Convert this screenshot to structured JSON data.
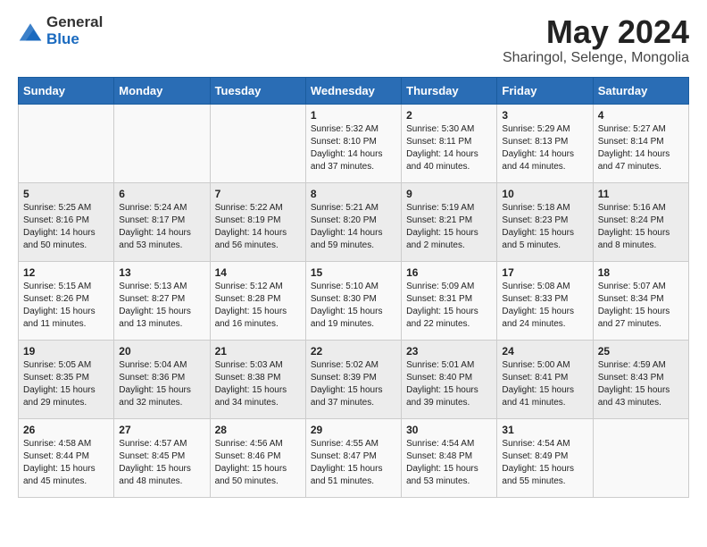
{
  "logo": {
    "general": "General",
    "blue": "Blue"
  },
  "title": "May 2024",
  "subtitle": "Sharingol, Selenge, Mongolia",
  "days_of_week": [
    "Sunday",
    "Monday",
    "Tuesday",
    "Wednesday",
    "Thursday",
    "Friday",
    "Saturday"
  ],
  "weeks": [
    [
      {
        "num": "",
        "info": ""
      },
      {
        "num": "",
        "info": ""
      },
      {
        "num": "",
        "info": ""
      },
      {
        "num": "1",
        "info": "Sunrise: 5:32 AM\nSunset: 8:10 PM\nDaylight: 14 hours and 37 minutes."
      },
      {
        "num": "2",
        "info": "Sunrise: 5:30 AM\nSunset: 8:11 PM\nDaylight: 14 hours and 40 minutes."
      },
      {
        "num": "3",
        "info": "Sunrise: 5:29 AM\nSunset: 8:13 PM\nDaylight: 14 hours and 44 minutes."
      },
      {
        "num": "4",
        "info": "Sunrise: 5:27 AM\nSunset: 8:14 PM\nDaylight: 14 hours and 47 minutes."
      }
    ],
    [
      {
        "num": "5",
        "info": "Sunrise: 5:25 AM\nSunset: 8:16 PM\nDaylight: 14 hours and 50 minutes."
      },
      {
        "num": "6",
        "info": "Sunrise: 5:24 AM\nSunset: 8:17 PM\nDaylight: 14 hours and 53 minutes."
      },
      {
        "num": "7",
        "info": "Sunrise: 5:22 AM\nSunset: 8:19 PM\nDaylight: 14 hours and 56 minutes."
      },
      {
        "num": "8",
        "info": "Sunrise: 5:21 AM\nSunset: 8:20 PM\nDaylight: 14 hours and 59 minutes."
      },
      {
        "num": "9",
        "info": "Sunrise: 5:19 AM\nSunset: 8:21 PM\nDaylight: 15 hours and 2 minutes."
      },
      {
        "num": "10",
        "info": "Sunrise: 5:18 AM\nSunset: 8:23 PM\nDaylight: 15 hours and 5 minutes."
      },
      {
        "num": "11",
        "info": "Sunrise: 5:16 AM\nSunset: 8:24 PM\nDaylight: 15 hours and 8 minutes."
      }
    ],
    [
      {
        "num": "12",
        "info": "Sunrise: 5:15 AM\nSunset: 8:26 PM\nDaylight: 15 hours and 11 minutes."
      },
      {
        "num": "13",
        "info": "Sunrise: 5:13 AM\nSunset: 8:27 PM\nDaylight: 15 hours and 13 minutes."
      },
      {
        "num": "14",
        "info": "Sunrise: 5:12 AM\nSunset: 8:28 PM\nDaylight: 15 hours and 16 minutes."
      },
      {
        "num": "15",
        "info": "Sunrise: 5:10 AM\nSunset: 8:30 PM\nDaylight: 15 hours and 19 minutes."
      },
      {
        "num": "16",
        "info": "Sunrise: 5:09 AM\nSunset: 8:31 PM\nDaylight: 15 hours and 22 minutes."
      },
      {
        "num": "17",
        "info": "Sunrise: 5:08 AM\nSunset: 8:33 PM\nDaylight: 15 hours and 24 minutes."
      },
      {
        "num": "18",
        "info": "Sunrise: 5:07 AM\nSunset: 8:34 PM\nDaylight: 15 hours and 27 minutes."
      }
    ],
    [
      {
        "num": "19",
        "info": "Sunrise: 5:05 AM\nSunset: 8:35 PM\nDaylight: 15 hours and 29 minutes."
      },
      {
        "num": "20",
        "info": "Sunrise: 5:04 AM\nSunset: 8:36 PM\nDaylight: 15 hours and 32 minutes."
      },
      {
        "num": "21",
        "info": "Sunrise: 5:03 AM\nSunset: 8:38 PM\nDaylight: 15 hours and 34 minutes."
      },
      {
        "num": "22",
        "info": "Sunrise: 5:02 AM\nSunset: 8:39 PM\nDaylight: 15 hours and 37 minutes."
      },
      {
        "num": "23",
        "info": "Sunrise: 5:01 AM\nSunset: 8:40 PM\nDaylight: 15 hours and 39 minutes."
      },
      {
        "num": "24",
        "info": "Sunrise: 5:00 AM\nSunset: 8:41 PM\nDaylight: 15 hours and 41 minutes."
      },
      {
        "num": "25",
        "info": "Sunrise: 4:59 AM\nSunset: 8:43 PM\nDaylight: 15 hours and 43 minutes."
      }
    ],
    [
      {
        "num": "26",
        "info": "Sunrise: 4:58 AM\nSunset: 8:44 PM\nDaylight: 15 hours and 45 minutes."
      },
      {
        "num": "27",
        "info": "Sunrise: 4:57 AM\nSunset: 8:45 PM\nDaylight: 15 hours and 48 minutes."
      },
      {
        "num": "28",
        "info": "Sunrise: 4:56 AM\nSunset: 8:46 PM\nDaylight: 15 hours and 50 minutes."
      },
      {
        "num": "29",
        "info": "Sunrise: 4:55 AM\nSunset: 8:47 PM\nDaylight: 15 hours and 51 minutes."
      },
      {
        "num": "30",
        "info": "Sunrise: 4:54 AM\nSunset: 8:48 PM\nDaylight: 15 hours and 53 minutes."
      },
      {
        "num": "31",
        "info": "Sunrise: 4:54 AM\nSunset: 8:49 PM\nDaylight: 15 hours and 55 minutes."
      },
      {
        "num": "",
        "info": ""
      }
    ]
  ]
}
